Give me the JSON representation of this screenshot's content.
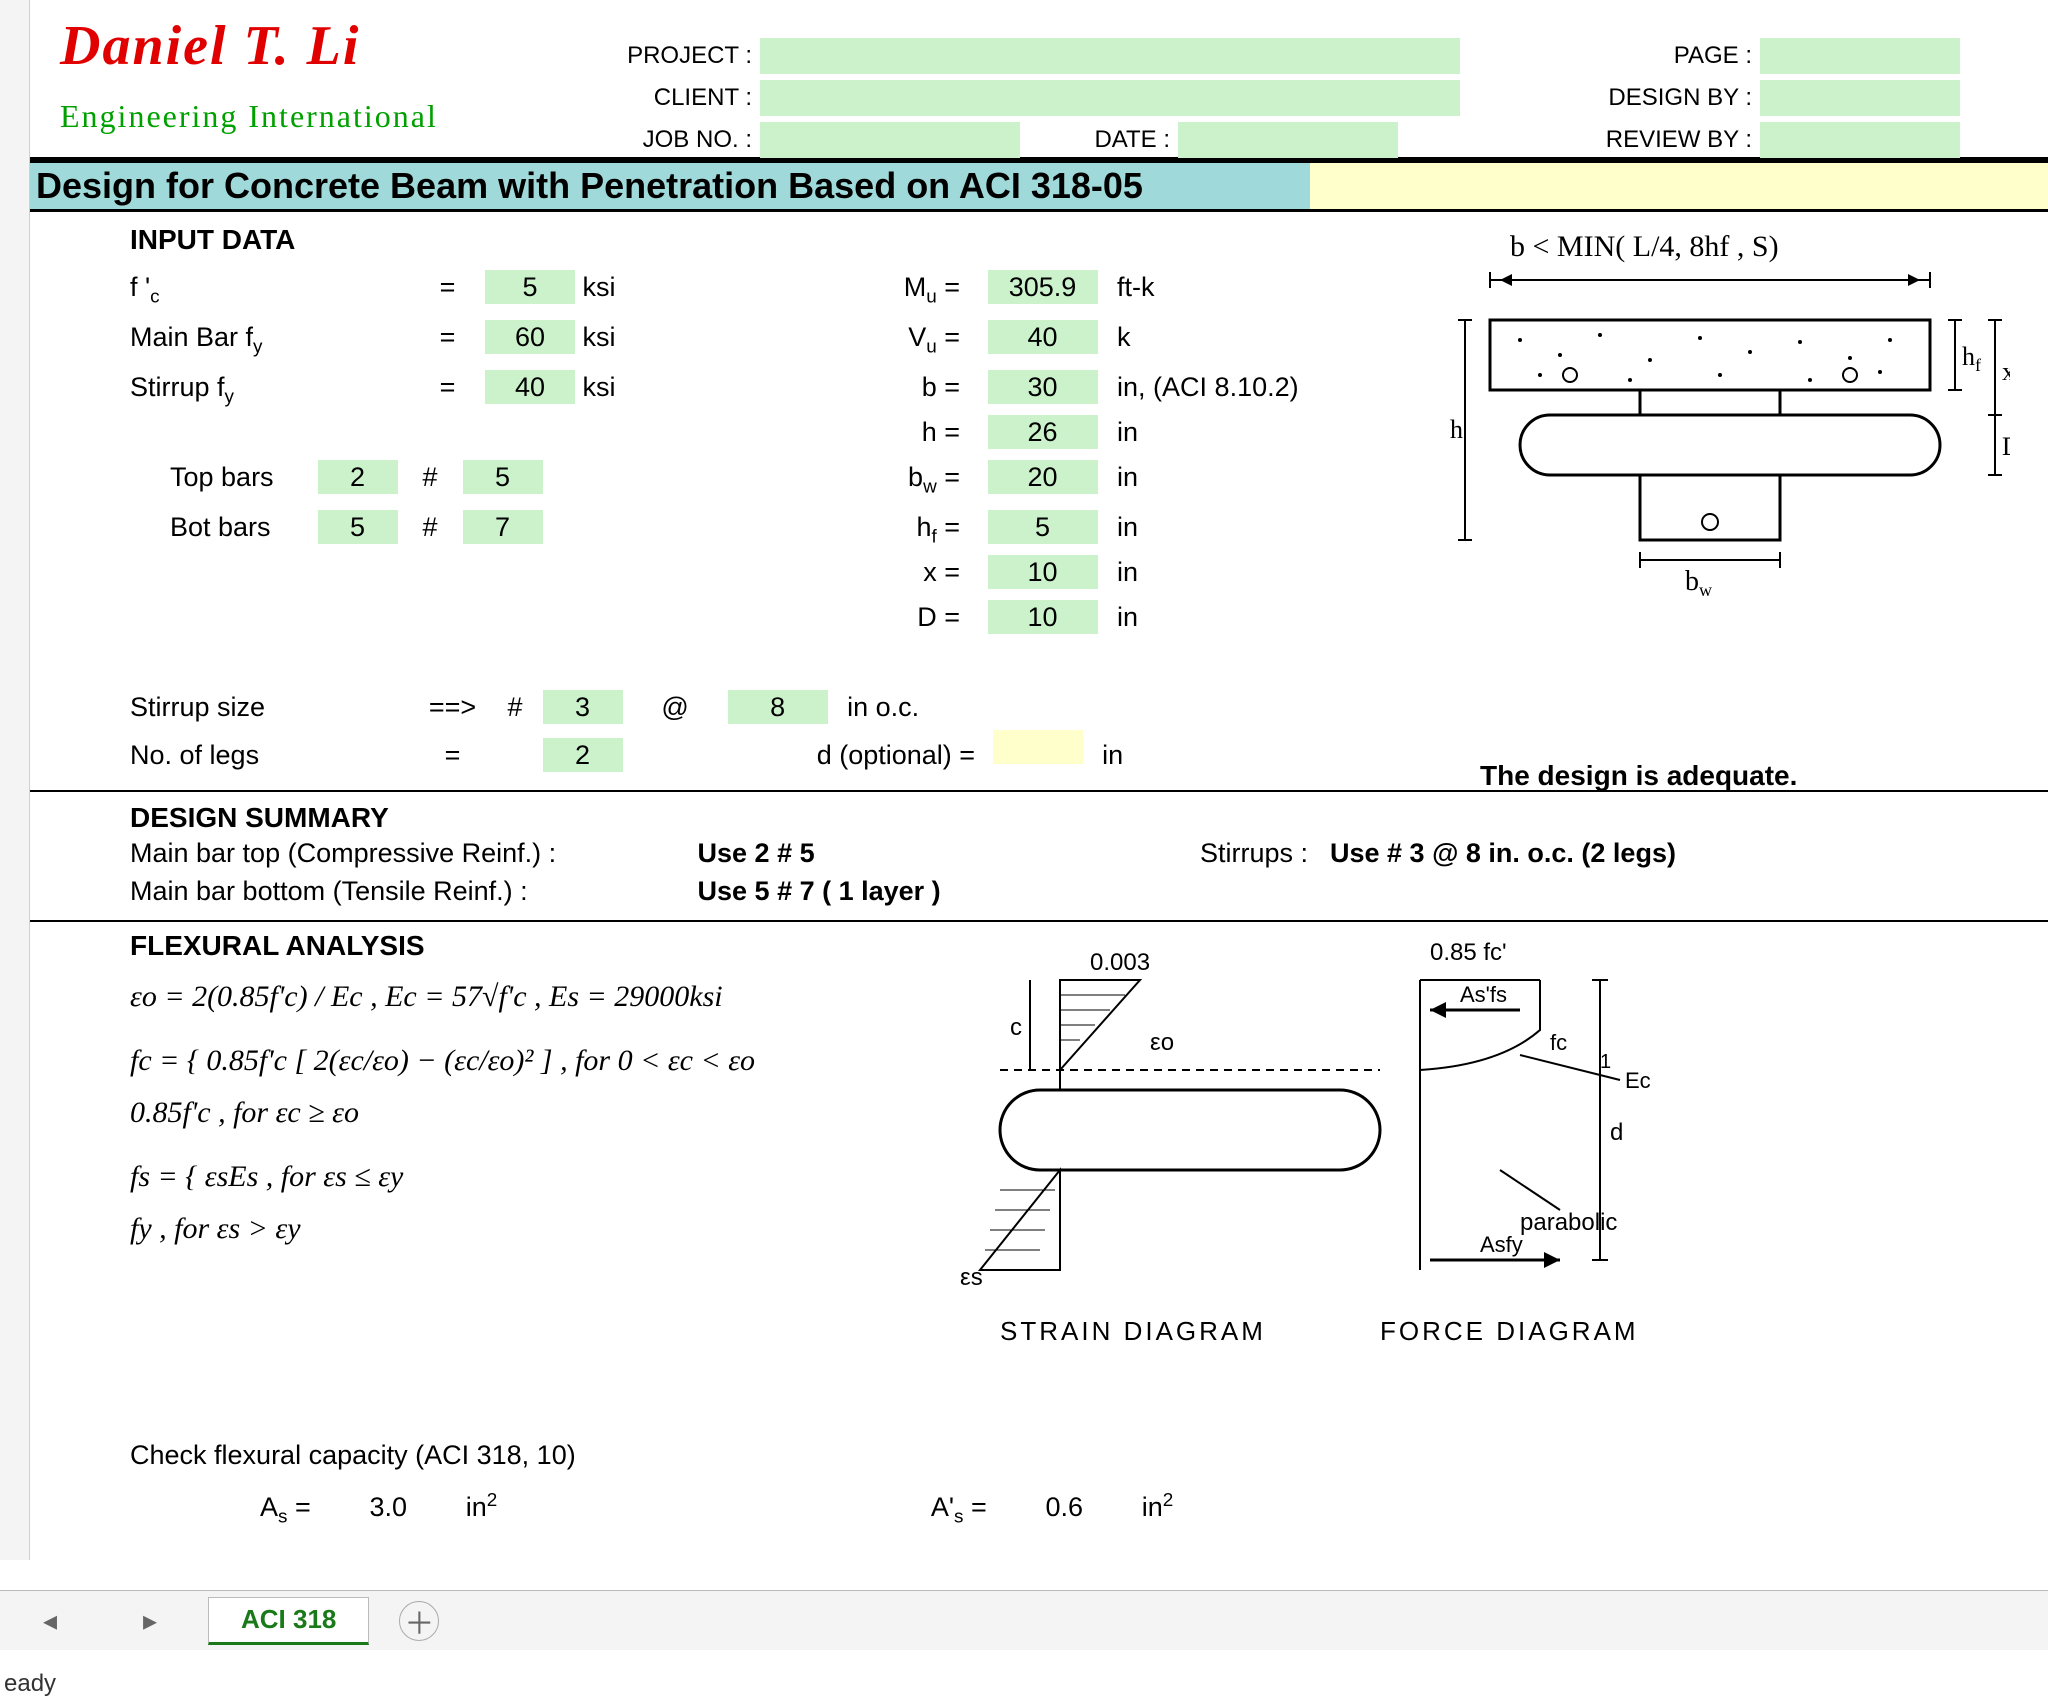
{
  "header": {
    "logo": "Daniel T. Li",
    "sublogo": "Engineering International",
    "project_label": "PROJECT :",
    "client_label": "CLIENT :",
    "jobno_label": "JOB NO. :",
    "date_label": "DATE :",
    "page_label": "PAGE :",
    "designby_label": "DESIGN BY :",
    "reviewby_label": "REVIEW BY :"
  },
  "title": "Design for Concrete Beam with  Penetration Based on ACI 318-05",
  "input": {
    "heading": "INPUT DATA",
    "fc_label": "f 'c",
    "fc_val": "5",
    "fc_unit": "ksi",
    "mainbar_fy_label": "Main Bar fy",
    "mainbar_fy_val": "60",
    "mainbar_fy_unit": "ksi",
    "stirrup_fy_label": "Stirrup fy",
    "stirrup_fy_val": "40",
    "stirrup_fy_unit": "ksi",
    "Mu_label": "Mu =",
    "Mu_val": "305.9",
    "Mu_unit": "ft-k",
    "Vu_label": "Vu =",
    "Vu_val": "40",
    "Vu_unit": "k",
    "b_label": "b =",
    "b_val": "30",
    "b_unit": "in, (ACI 8.10.2)",
    "h_label": "h =",
    "h_val": "26",
    "h_unit": "in",
    "bw_label": "bw =",
    "bw_val": "20",
    "bw_unit": "in",
    "hf_label": "hf =",
    "hf_val": "5",
    "hf_unit": "in",
    "x_label": "x =",
    "x_val": "10",
    "x_unit": "in",
    "D_label": "D =",
    "D_val": "10",
    "D_unit": "in",
    "topbars_label": "Top bars",
    "topbars_n": "2",
    "topbars_size": "5",
    "botbars_label": "Bot bars",
    "botbars_n": "5",
    "botbars_size": "7",
    "hash": "#",
    "stirrup_size_label": "Stirrup size",
    "arrow": "==>",
    "stirrup_size_val": "3",
    "at": "@",
    "stirrup_spacing": "8",
    "stirrup_unit": "in o.c.",
    "legs_label": "No. of legs",
    "legs_val": "2",
    "d_opt_label": "d (optional) =",
    "d_opt_unit": "in"
  },
  "diagram_note": "b  <  MIN( L/4, 8hf , S)",
  "adequate": "The design is adequate.",
  "summary": {
    "heading": "DESIGN SUMMARY",
    "top_label": "Main bar top (Compressive Reinf.) :",
    "top_val": "Use  2 # 5",
    "bot_label": "Main bar bottom (Tensile Reinf.) :",
    "bot_val": "Use  5 # 7 ( 1 layer )",
    "stirrups_label": "Stirrups :",
    "stirrups_val": "Use # 3 @ 8 in. o.c.   (2 legs)"
  },
  "flexural": {
    "heading": "FLEXURAL ANALYSIS",
    "line1": "εo = 2(0.85f'c) / Ec ,   Ec = 57√f'c  ,   Es = 29000ksi",
    "line2a": "fc = { 0.85f'c [ 2(εc/εo) − (εc/εo)² ] ,  for  0 < εc < εo",
    "line2b": "        0.85f'c  ,   for  εc ≥ εo",
    "line3a": "fs = { εsEs  ,   for  εs ≤ εy",
    "line3b": "        fy  ,   for  εs > εy",
    "check": "Check flexural capacity (ACI 318, 10)",
    "As_label": "As =",
    "As_val": "3.0",
    "As_unit": "in²",
    "Aps_label": "A's =",
    "Aps_val": "0.6",
    "Aps_unit": "in²"
  },
  "strain": {
    "top003": "0.003",
    "eps_o": "εo",
    "eps_s": "εs",
    "label1": "STRAIN  DIAGRAM",
    "label2": "FORCE  DIAGRAM",
    "085fc": "0.85 fc'",
    "Asfs": "As'fs",
    "fc": "fc",
    "Ec": "Ec",
    "parabolic": "parabolic",
    "Asfy": "Asfy",
    "c": "c",
    "d": "d",
    "one": "1"
  },
  "tab": "ACI 318",
  "status": "eady"
}
